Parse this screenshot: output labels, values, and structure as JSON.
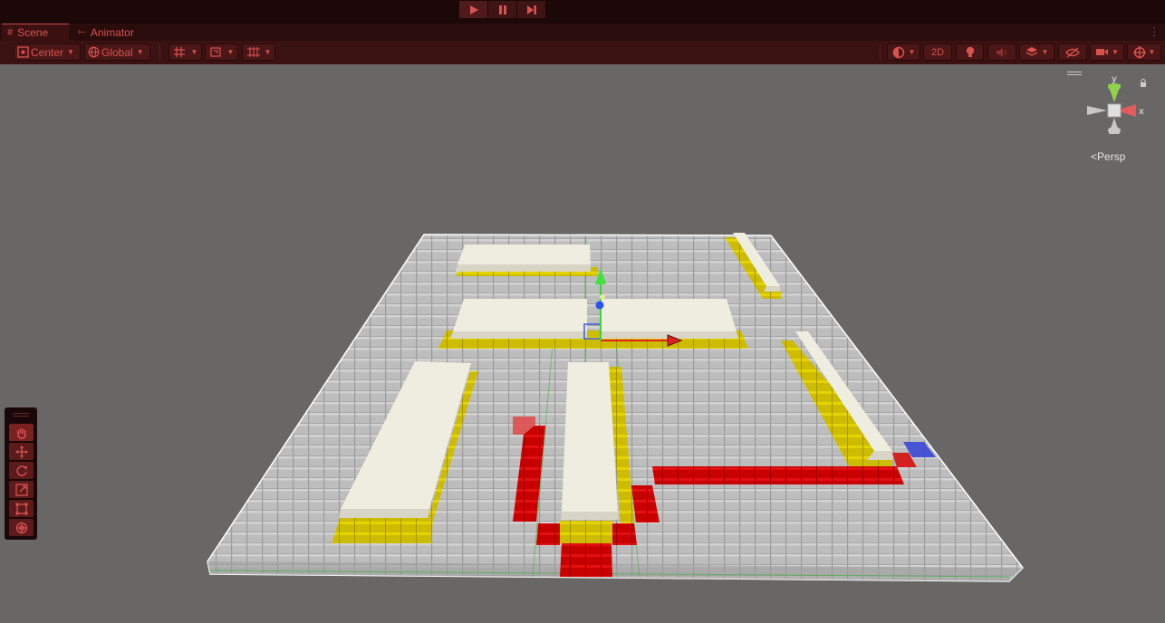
{
  "window": {
    "play_state": "play-active"
  },
  "tabs": [
    {
      "label": "Scene",
      "icon": "grid-icon",
      "active": true
    },
    {
      "label": "Animator",
      "icon": "animator-icon",
      "active": false
    }
  ],
  "toolbar": {
    "pivot_label": "Center",
    "space_label": "Global",
    "mode_2d_label": "2D"
  },
  "view": {
    "projection_label": "Persp",
    "axis_y": "y",
    "axis_x": "x"
  },
  "colors": {
    "accent": "#d9524f",
    "bar": "#3a1212",
    "scene_bg": "#696766",
    "floor": "#bdbdbd",
    "wall": "#ece9d6",
    "yellow": "#d8c800",
    "red": "#d40000",
    "blue": "#2a3ccc"
  }
}
